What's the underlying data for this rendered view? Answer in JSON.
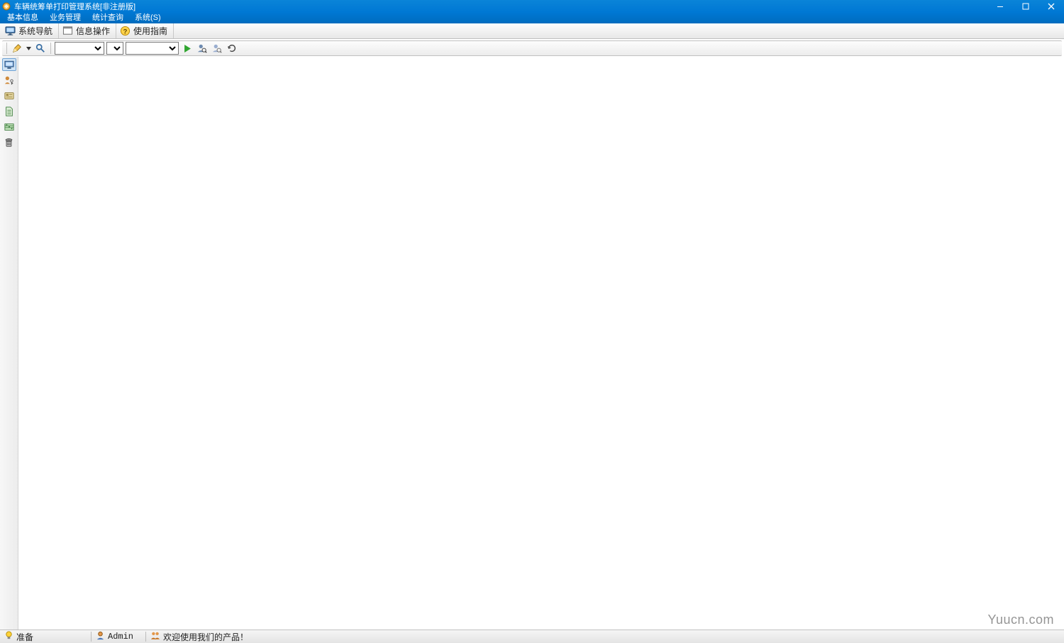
{
  "title": "车辆统筹单打印管理系统[非注册版]",
  "menu": {
    "items": [
      {
        "label": "基本信息"
      },
      {
        "label": "业务管理"
      },
      {
        "label": "统计查询"
      },
      {
        "label": "系统(S)"
      }
    ]
  },
  "main_toolbar": {
    "items": [
      {
        "icon": "monitor-icon",
        "label": "系统导航"
      },
      {
        "icon": "window-icon",
        "label": "信息操作"
      },
      {
        "icon": "help-icon",
        "label": "使用指南"
      }
    ]
  },
  "sub_toolbar": {
    "combo1": "",
    "combo2": "",
    "combo3": ""
  },
  "side_icons": [
    "screen-icon",
    "user-key-icon",
    "card-icon",
    "document-icon",
    "abacus-icon",
    "phone-icon"
  ],
  "status": {
    "ready": "准备",
    "user": "Admin",
    "welcome": "欢迎使用我们的产品！"
  },
  "watermark": "Yuucn.com"
}
